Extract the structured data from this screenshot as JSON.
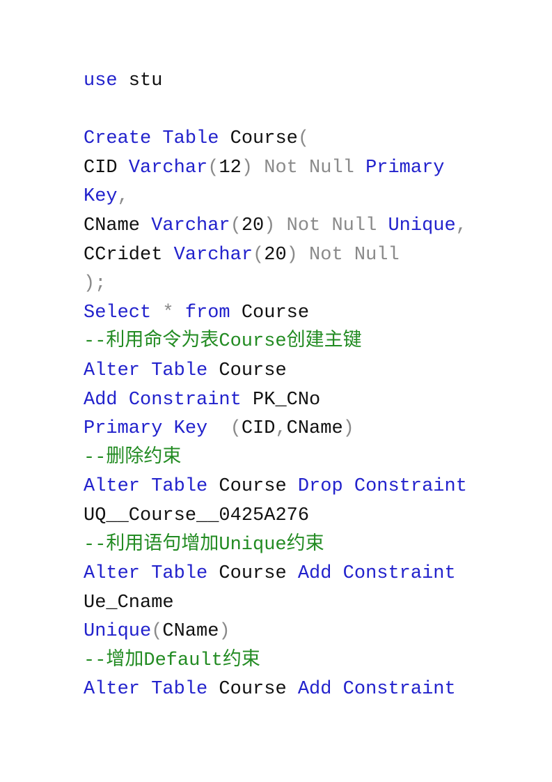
{
  "colors": {
    "keyword": "#2222cc",
    "operator": "#8a8a8a",
    "comment": "#228b22",
    "identifier": "#111111"
  },
  "lines": [
    [
      {
        "t": "kw",
        "v": "use"
      },
      {
        "t": "id",
        "v": " stu"
      }
    ],
    [],
    [
      {
        "t": "kw",
        "v": "Create"
      },
      {
        "t": "id",
        "v": " "
      },
      {
        "t": "kw",
        "v": "Table"
      },
      {
        "t": "id",
        "v": " Course"
      },
      {
        "t": "gr",
        "v": "("
      }
    ],
    [
      {
        "t": "id",
        "v": "CID "
      },
      {
        "t": "kw",
        "v": "Varchar"
      },
      {
        "t": "gr",
        "v": "("
      },
      {
        "t": "id",
        "v": "12"
      },
      {
        "t": "gr",
        "v": ") Not Null "
      },
      {
        "t": "kw",
        "v": "Primary"
      }
    ],
    [
      {
        "t": "kw",
        "v": "Key"
      },
      {
        "t": "gr",
        "v": ","
      }
    ],
    [
      {
        "t": "id",
        "v": "CName "
      },
      {
        "t": "kw",
        "v": "Varchar"
      },
      {
        "t": "gr",
        "v": "("
      },
      {
        "t": "id",
        "v": "20"
      },
      {
        "t": "gr",
        "v": ") Not Null "
      },
      {
        "t": "kw",
        "v": "Unique"
      },
      {
        "t": "gr",
        "v": ","
      }
    ],
    [
      {
        "t": "id",
        "v": "CCridet "
      },
      {
        "t": "kw",
        "v": "Varchar"
      },
      {
        "t": "gr",
        "v": "("
      },
      {
        "t": "id",
        "v": "20"
      },
      {
        "t": "gr",
        "v": ") Not Null"
      }
    ],
    [
      {
        "t": "gr",
        "v": ");"
      }
    ],
    [
      {
        "t": "kw",
        "v": "Select"
      },
      {
        "t": "gr",
        "v": " * "
      },
      {
        "t": "kw",
        "v": "from"
      },
      {
        "t": "id",
        "v": " Course"
      }
    ],
    [
      {
        "t": "cm",
        "v": "--利用命令为表Course创建主键"
      }
    ],
    [
      {
        "t": "kw",
        "v": "Alter"
      },
      {
        "t": "id",
        "v": " "
      },
      {
        "t": "kw",
        "v": "Table"
      },
      {
        "t": "id",
        "v": " Course"
      }
    ],
    [
      {
        "t": "kw",
        "v": "Add"
      },
      {
        "t": "id",
        "v": " "
      },
      {
        "t": "kw",
        "v": "Constraint"
      },
      {
        "t": "id",
        "v": " PK_CNo"
      }
    ],
    [
      {
        "t": "kw",
        "v": "Primary"
      },
      {
        "t": "id",
        "v": " "
      },
      {
        "t": "kw",
        "v": "Key"
      },
      {
        "t": "gr",
        "v": "  ("
      },
      {
        "t": "id",
        "v": "CID"
      },
      {
        "t": "gr",
        "v": ","
      },
      {
        "t": "id",
        "v": "CName"
      },
      {
        "t": "gr",
        "v": ")"
      }
    ],
    [
      {
        "t": "cm",
        "v": "--删除约束"
      }
    ],
    [
      {
        "t": "kw",
        "v": "Alter"
      },
      {
        "t": "id",
        "v": " "
      },
      {
        "t": "kw",
        "v": "Table"
      },
      {
        "t": "id",
        "v": " Course "
      },
      {
        "t": "kw",
        "v": "Drop"
      },
      {
        "t": "id",
        "v": " "
      },
      {
        "t": "kw",
        "v": "Constraint"
      }
    ],
    [
      {
        "t": "id",
        "v": "UQ__Course__0425A276"
      }
    ],
    [
      {
        "t": "cm",
        "v": "--利用语句增加Unique约束"
      }
    ],
    [
      {
        "t": "kw",
        "v": "Alter"
      },
      {
        "t": "id",
        "v": " "
      },
      {
        "t": "kw",
        "v": "Table"
      },
      {
        "t": "id",
        "v": " Course "
      },
      {
        "t": "kw",
        "v": "Add"
      },
      {
        "t": "id",
        "v": " "
      },
      {
        "t": "kw",
        "v": "Constraint"
      }
    ],
    [
      {
        "t": "id",
        "v": "Ue_Cname"
      }
    ],
    [
      {
        "t": "kw",
        "v": "Unique"
      },
      {
        "t": "gr",
        "v": "("
      },
      {
        "t": "id",
        "v": "CName"
      },
      {
        "t": "gr",
        "v": ")"
      }
    ],
    [
      {
        "t": "cm",
        "v": "--增加Default约束"
      }
    ],
    [
      {
        "t": "kw",
        "v": "Alter"
      },
      {
        "t": "id",
        "v": " "
      },
      {
        "t": "kw",
        "v": "Table"
      },
      {
        "t": "id",
        "v": " Course "
      },
      {
        "t": "kw",
        "v": "Add"
      },
      {
        "t": "id",
        "v": " "
      },
      {
        "t": "kw",
        "v": "Constraint"
      }
    ]
  ]
}
